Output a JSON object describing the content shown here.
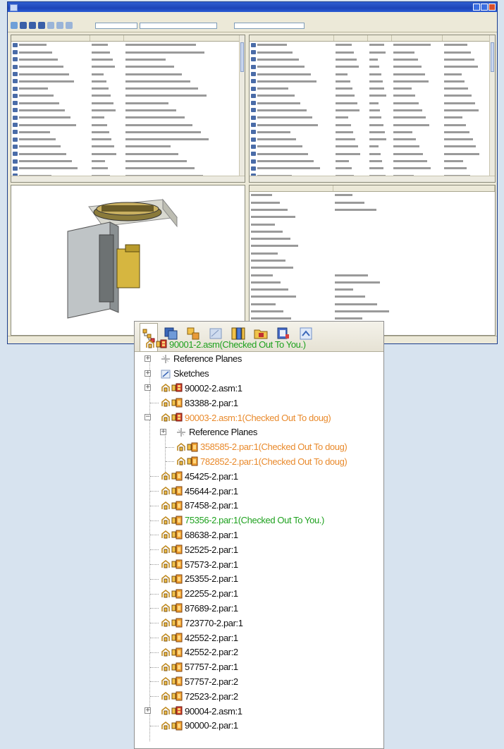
{
  "tree": {
    "tabs": [
      {
        "icon": "feature-tree-icon",
        "active": true
      },
      {
        "icon": "layers-icon"
      },
      {
        "icon": "assembly-icon"
      },
      {
        "icon": "sketch-icon"
      },
      {
        "icon": "relations-icon"
      },
      {
        "icon": "folder-icon"
      },
      {
        "icon": "library-icon"
      },
      {
        "icon": "explode-icon"
      }
    ],
    "rows": [
      {
        "text": "90001-2.asm(Checked Out To You.)",
        "indent": 0,
        "expander": "",
        "icon": "asm",
        "status": "green"
      },
      {
        "text": "Reference Planes",
        "indent": 1,
        "expander": "+",
        "icon": "planes",
        "status": "normal"
      },
      {
        "text": "Sketches",
        "indent": 1,
        "expander": "+",
        "icon": "sketch",
        "status": "normal"
      },
      {
        "text": "90002-2.asm:1",
        "indent": 1,
        "expander": "+",
        "icon": "asm",
        "status": "normal"
      },
      {
        "text": "83388-2.par:1",
        "indent": 1,
        "expander": "",
        "icon": "par",
        "status": "normal"
      },
      {
        "text": "90003-2.asm:1(Checked Out To doug)",
        "indent": 1,
        "expander": "−",
        "icon": "asm",
        "status": "orange"
      },
      {
        "text": "Reference Planes",
        "indent": 2,
        "expander": "+",
        "icon": "planes",
        "status": "normal"
      },
      {
        "text": "358585-2.par:1(Checked Out To doug)",
        "indent": 2,
        "expander": "",
        "icon": "par",
        "status": "orange"
      },
      {
        "text": "782852-2.par:1(Checked Out To doug)",
        "indent": 2,
        "expander": "",
        "icon": "par",
        "status": "orange"
      },
      {
        "text": "45425-2.par:1",
        "indent": 1,
        "expander": "",
        "icon": "par",
        "status": "normal"
      },
      {
        "text": "45644-2.par:1",
        "indent": 1,
        "expander": "",
        "icon": "par",
        "status": "normal"
      },
      {
        "text": "87458-2.par:1",
        "indent": 1,
        "expander": "",
        "icon": "par",
        "status": "normal"
      },
      {
        "text": "75356-2.par:1(Checked Out To You.)",
        "indent": 1,
        "expander": "",
        "icon": "par",
        "status": "green"
      },
      {
        "text": "68638-2.par:1",
        "indent": 1,
        "expander": "",
        "icon": "par",
        "status": "normal"
      },
      {
        "text": "52525-2.par:1",
        "indent": 1,
        "expander": "",
        "icon": "par",
        "status": "normal"
      },
      {
        "text": "57573-2.par:1",
        "indent": 1,
        "expander": "",
        "icon": "par",
        "status": "normal"
      },
      {
        "text": "25355-2.par:1",
        "indent": 1,
        "expander": "",
        "icon": "par",
        "status": "normal"
      },
      {
        "text": "22255-2.par:1",
        "indent": 1,
        "expander": "",
        "icon": "par",
        "status": "normal"
      },
      {
        "text": "87689-2.par:1",
        "indent": 1,
        "expander": "",
        "icon": "par",
        "status": "normal"
      },
      {
        "text": "723770-2.par:1",
        "indent": 1,
        "expander": "",
        "icon": "par",
        "status": "normal"
      },
      {
        "text": "42552-2.par:1",
        "indent": 1,
        "expander": "",
        "icon": "par",
        "status": "normal"
      },
      {
        "text": "42552-2.par:2",
        "indent": 1,
        "expander": "",
        "icon": "par",
        "status": "normal"
      },
      {
        "text": "57757-2.par:1",
        "indent": 1,
        "expander": "",
        "icon": "par",
        "status": "normal"
      },
      {
        "text": "57757-2.par:2",
        "indent": 1,
        "expander": "",
        "icon": "par",
        "status": "normal"
      },
      {
        "text": "72523-2.par:2",
        "indent": 1,
        "expander": "",
        "icon": "par",
        "status": "normal"
      },
      {
        "text": "90004-2.asm:1",
        "indent": 1,
        "expander": "+",
        "icon": "asm",
        "status": "normal"
      },
      {
        "text": "90000-2.par:1",
        "indent": 1,
        "expander": "",
        "icon": "par",
        "status": "normal"
      }
    ]
  },
  "colors": {
    "green": "#1ea11e",
    "orange": "#e98a2c",
    "normal": "#111111"
  }
}
